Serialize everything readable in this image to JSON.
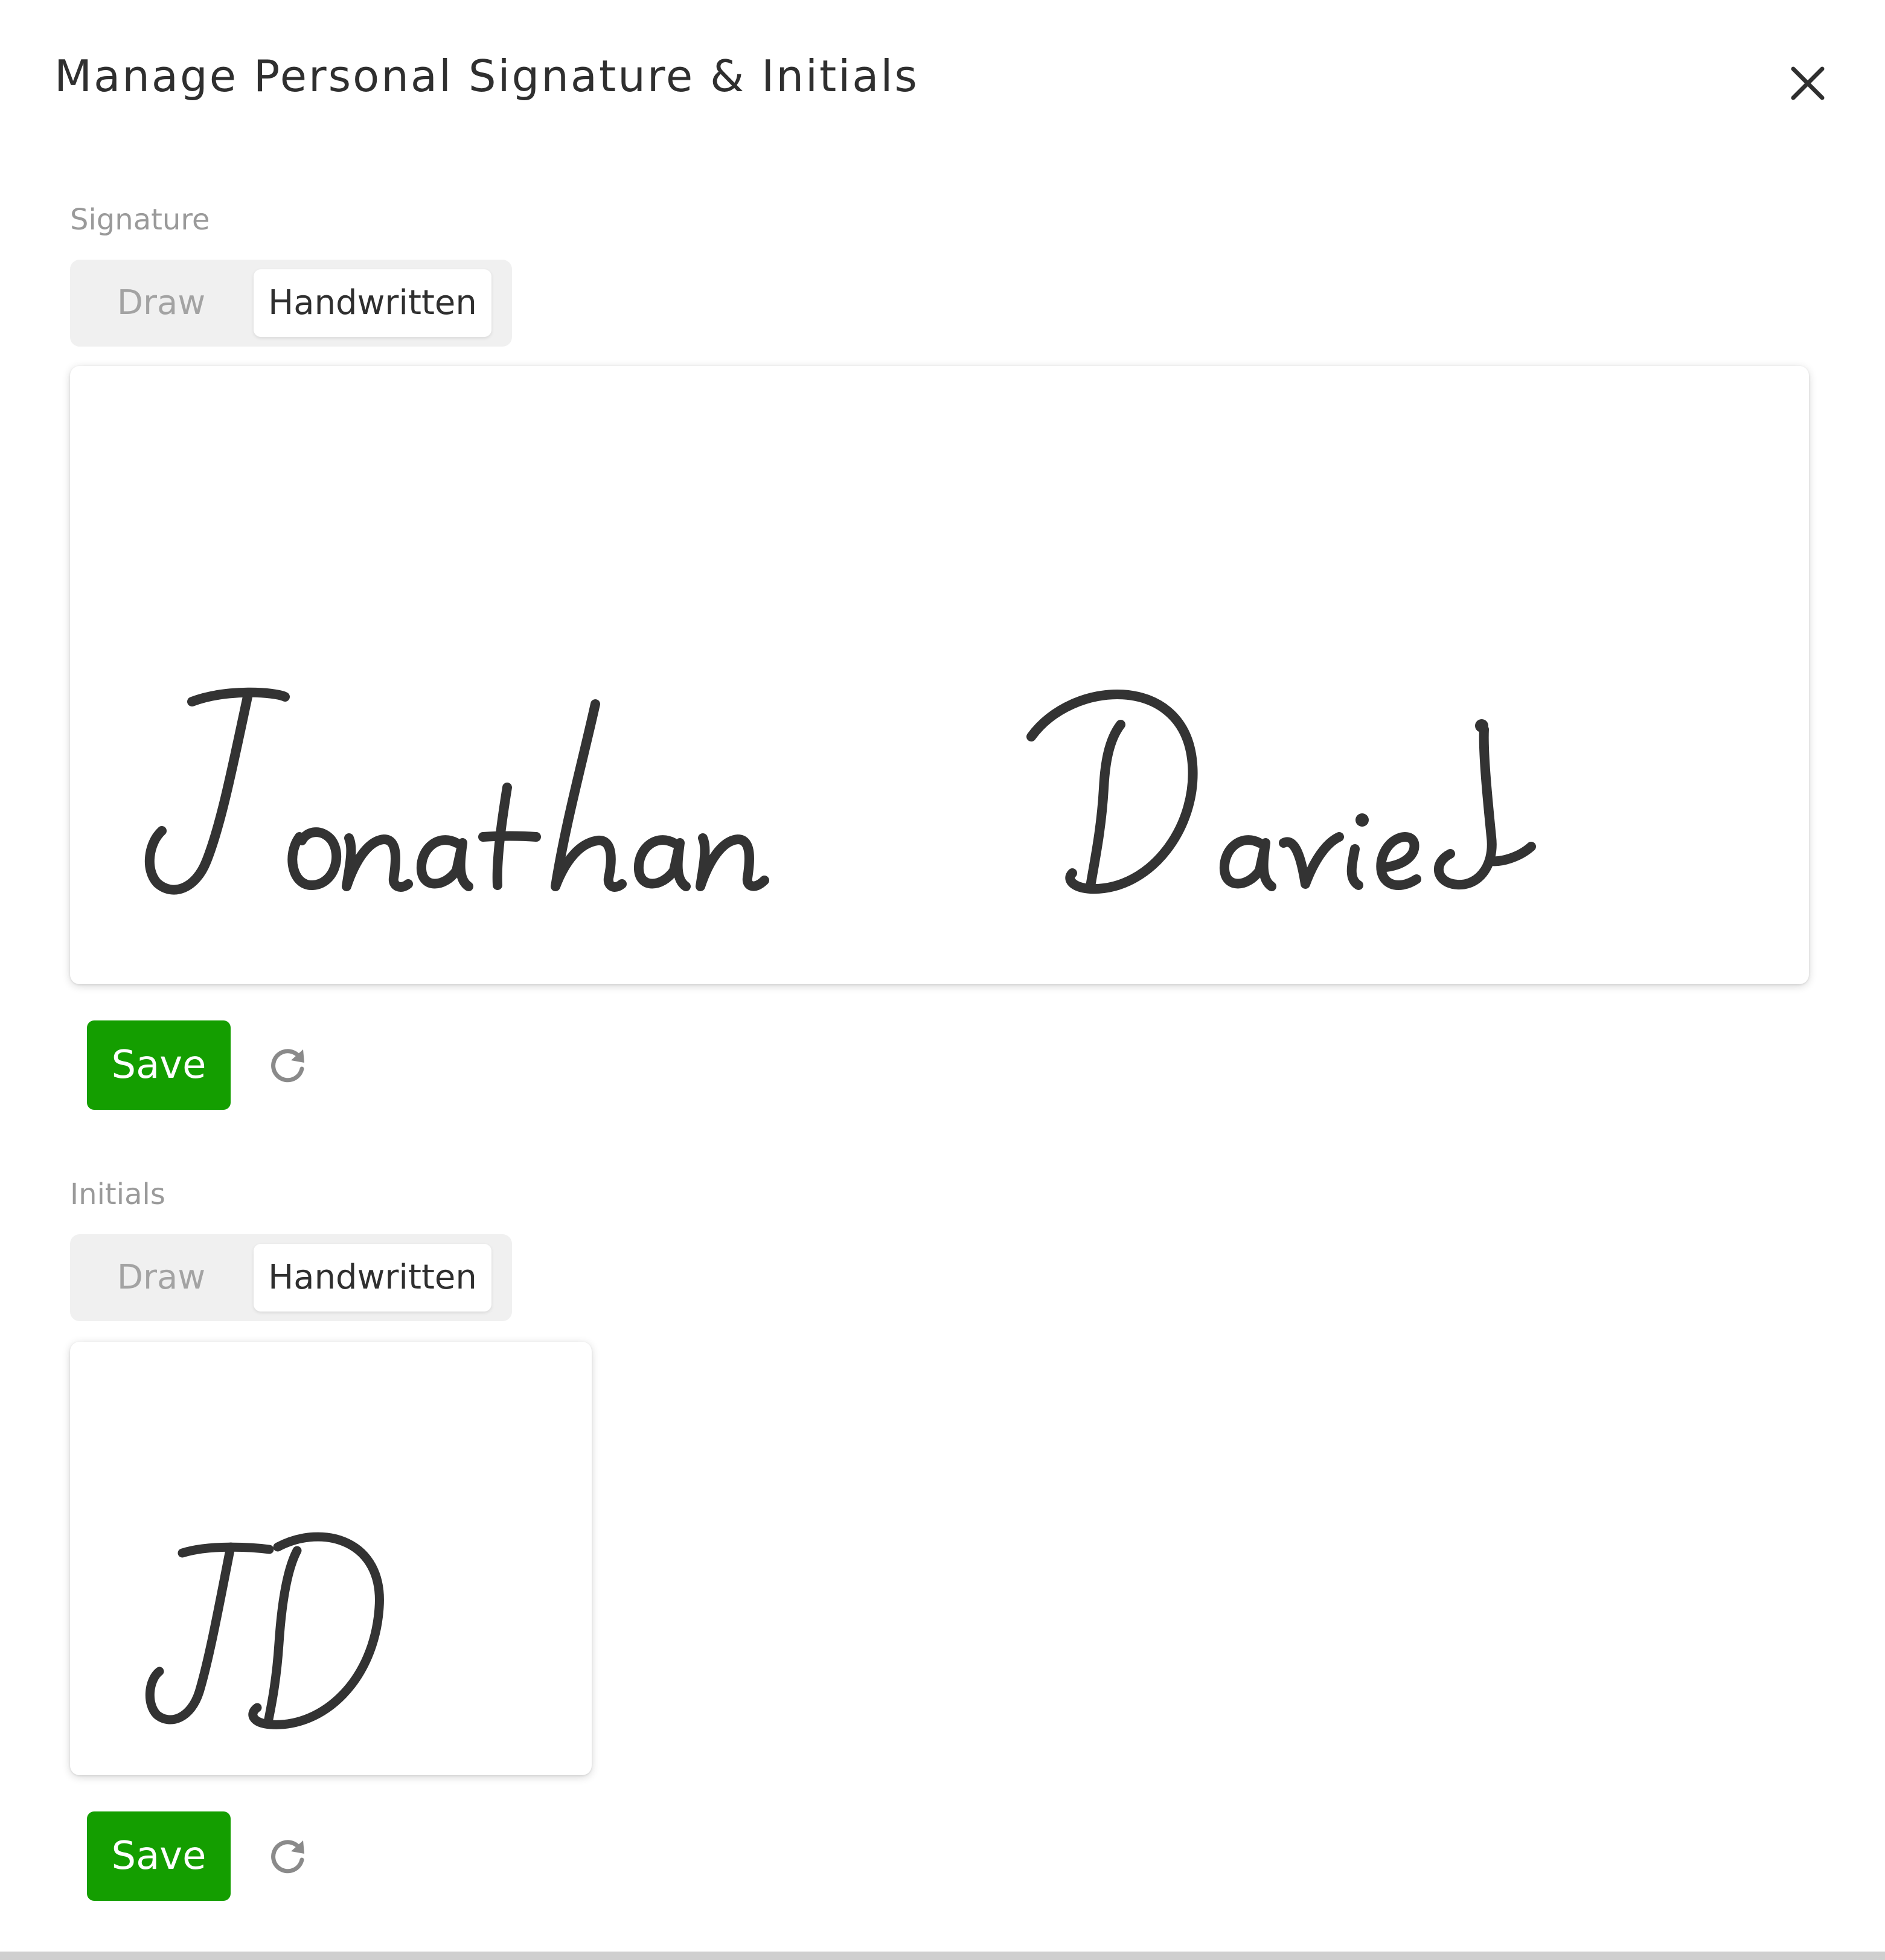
{
  "dialog": {
    "title": "Manage Personal Signature & Initials",
    "close_icon": "close-icon"
  },
  "signature": {
    "label": "Signature",
    "modes": [
      "Draw",
      "Handwritten"
    ],
    "selected_mode": "Handwritten",
    "handwritten_text": "Jonathan Davies",
    "save_label": "Save",
    "reset_icon": "refresh-icon"
  },
  "initials": {
    "label": "Initials",
    "modes": [
      "Draw",
      "Handwritten"
    ],
    "selected_mode": "Handwritten",
    "handwritten_text": "JD",
    "save_label": "Save",
    "reset_icon": "refresh-icon"
  },
  "colors": {
    "save_button": "#149e00",
    "ink": "#333333",
    "toggle_bg": "#f0f0f0",
    "label": "#9a9a9a"
  }
}
